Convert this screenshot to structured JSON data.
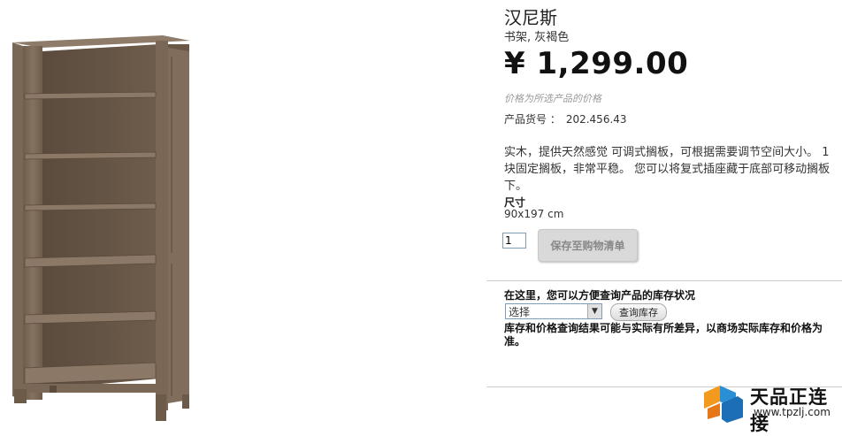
{
  "product": {
    "name": "汉尼斯",
    "subtitle": "书架, 灰褐色",
    "price": "¥ 1,299.00",
    "price_note": "价格为所选产品的价格",
    "article_label": "产品货号 ：",
    "article_number": "202.456.43",
    "description": "实木，提供天然感觉 可调式搁板，可根据需要调节空间大小。 1块固定搁板，非常平稳。 您可以将复式插座藏于底部可移动搁板下。",
    "dimensions_label": "尺寸",
    "dimensions_value": "90x197 cm"
  },
  "cart": {
    "quantity": "1",
    "save_label": "保存至购物清单"
  },
  "stock": {
    "title": "在这里，您可以方便查询产品的库存状况",
    "select_value": "选择",
    "check_label": "查询库存",
    "disclaimer": "库存和价格查询结果可能与实际有所差异，以商场实际库存和价格为准。"
  },
  "watermark": {
    "text": "天品正连接",
    "url": "www.tpzlj.com"
  },
  "colors": {
    "wood": "#7d6a58",
    "wood_dark": "#5e4f41",
    "button_bg": "#d9d9d9"
  },
  "icons": {
    "logo": "tpzlj-cube-logo",
    "select_arrow": "triangle-down-icon"
  }
}
